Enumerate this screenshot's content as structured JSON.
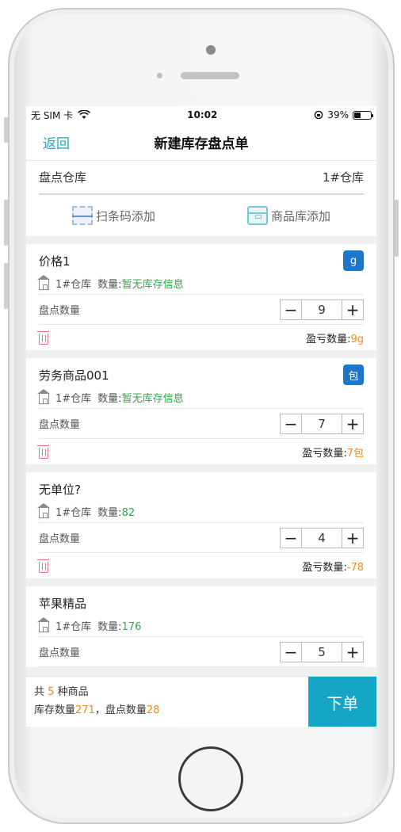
{
  "status_bar": {
    "carrier": "无 SIM 卡",
    "time": "10:02",
    "battery": "39%"
  },
  "nav": {
    "back_label": "返回",
    "title": "新建库存盘点单"
  },
  "warehouse": {
    "label": "盘点仓库",
    "value": "1#仓库"
  },
  "add_actions": {
    "scan_label": "扫条码添加",
    "library_label": "商品库添加"
  },
  "items": [
    {
      "name": "价格1",
      "unit": "g",
      "warehouse": "1#仓库",
      "qty_label": "数量:",
      "qty_value": "暂无库存信息",
      "count_label": "盘点数量",
      "count": "9",
      "diff_label": "盈亏数量:",
      "diff_value": "9g"
    },
    {
      "name": "劳务商品001",
      "unit": "包",
      "warehouse": "1#仓库",
      "qty_label": "数量:",
      "qty_value": "暂无库存信息",
      "count_label": "盘点数量",
      "count": "7",
      "diff_label": "盈亏数量:",
      "diff_value": "7包"
    },
    {
      "name": "无单位?",
      "unit": "",
      "warehouse": "1#仓库",
      "qty_label": "数量:",
      "qty_value": "82",
      "count_label": "盘点数量",
      "count": "4",
      "diff_label": "盈亏数量:",
      "diff_value": "-78"
    },
    {
      "name": "苹果精品",
      "unit": "",
      "warehouse": "1#仓库",
      "qty_label": "数量:",
      "qty_value": "176",
      "count_label": "盘点数量",
      "count": "5",
      "diff_label": "",
      "diff_value": ""
    }
  ],
  "summary": {
    "prefix": "共",
    "count": "5",
    "suffix": "种商品",
    "stock_label": "库存数量",
    "stock_value": "271",
    "sep": "，",
    "counted_label": "盘点数量",
    "counted_value": "28"
  },
  "order_button": "下单",
  "stepper_minus": "−",
  "stepper_plus": "+",
  "colors": {
    "accent": "#14a6c4",
    "badge": "#1e76c8",
    "green": "#2fa84f",
    "orange": "#f08a1a",
    "trash": "#e87575"
  }
}
